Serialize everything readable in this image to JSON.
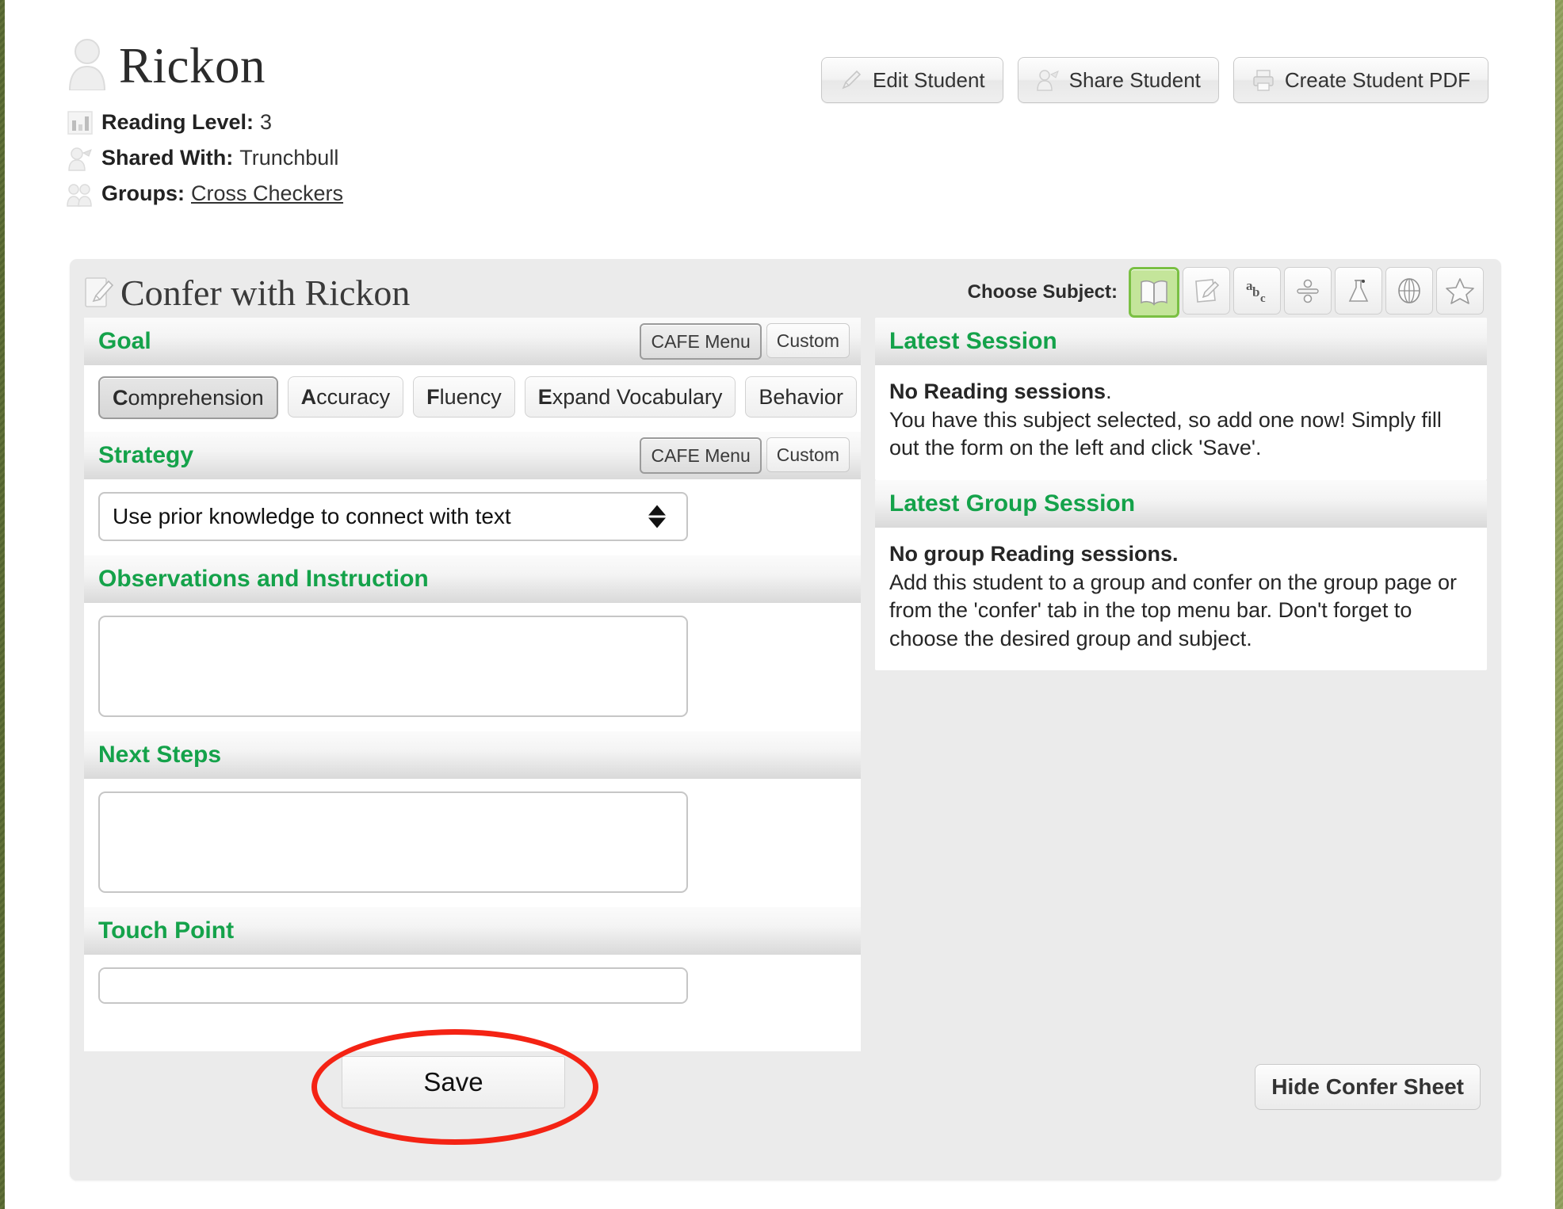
{
  "student": {
    "name": "Rickon",
    "avatar_icon": "user-icon",
    "meta": [
      {
        "icon": "bar-chart-icon",
        "label": "Reading Level:",
        "value": "3",
        "link": false
      },
      {
        "icon": "share-person-icon",
        "label": "Shared With:",
        "value": "Trunchbull",
        "link": false
      },
      {
        "icon": "group-people-icon",
        "label": "Groups:",
        "value": "Cross Checkers",
        "link": true
      }
    ]
  },
  "top_actions": [
    {
      "label": "Edit Student",
      "icon": "pencil-icon"
    },
    {
      "label": "Share Student",
      "icon": "share-person-icon"
    },
    {
      "label": "Create Student PDF",
      "icon": "printer-icon"
    }
  ],
  "confer": {
    "title": "Confer with Rickon",
    "title_icon": "note-pencil-icon",
    "subject_label": "Choose Subject:",
    "subjects": [
      {
        "name": "reading",
        "icon": "open-book-icon",
        "selected": true
      },
      {
        "name": "writing",
        "icon": "notepad-pencil-icon",
        "selected": false
      },
      {
        "name": "word-work",
        "icon": "abc-icon",
        "selected": false
      },
      {
        "name": "math",
        "icon": "division-icon",
        "selected": false
      },
      {
        "name": "science",
        "icon": "flask-icon",
        "selected": false
      },
      {
        "name": "social-studies",
        "icon": "globe-icon",
        "selected": false
      },
      {
        "name": "other",
        "icon": "star-icon",
        "selected": false
      }
    ],
    "selected_subject_color": "#7ac043"
  },
  "goal": {
    "heading": "Goal",
    "cafe_menu_label": "CAFE Menu",
    "custom_label": "Custom",
    "options": [
      {
        "initial": "C",
        "rest": "omprehension",
        "selected": true
      },
      {
        "initial": "A",
        "rest": "ccuracy",
        "selected": false
      },
      {
        "initial": "F",
        "rest": "luency",
        "selected": false
      },
      {
        "initial": "E",
        "rest": "xpand Vocabulary",
        "selected": false
      },
      {
        "initial": "",
        "rest": "Behavior",
        "selected": false
      }
    ]
  },
  "strategy": {
    "heading": "Strategy",
    "cafe_menu_label": "CAFE Menu",
    "custom_label": "Custom",
    "selected_option": "Use prior knowledge to connect with text"
  },
  "observations": {
    "heading": "Observations and Instruction",
    "value": "",
    "placeholder": ""
  },
  "next_steps": {
    "heading": "Next Steps",
    "value": "",
    "placeholder": ""
  },
  "touch_point": {
    "heading": "Touch Point",
    "value": "",
    "placeholder": ""
  },
  "save": {
    "label": "Save",
    "annotation_color": "#f42314"
  },
  "latest_session": {
    "heading": "Latest Session",
    "bold_text": "No Reading sessions",
    "bold_suffix": ".",
    "body": "You have this subject selected, so add one now! Simply fill out the form on the left and click 'Save'."
  },
  "latest_group_session": {
    "heading": "Latest Group Session",
    "bold_text": "No group Reading sessions.",
    "body": "Add this student to a group and confer on the group page or from the 'confer' tab in the top menu bar. Don't forget to choose the desired group and subject."
  },
  "hide_confer": {
    "label": "Hide Confer Sheet"
  },
  "theme": {
    "green": "#14a24a",
    "accent_green": "#7ac043",
    "panel_bg": "#ebebeb"
  }
}
